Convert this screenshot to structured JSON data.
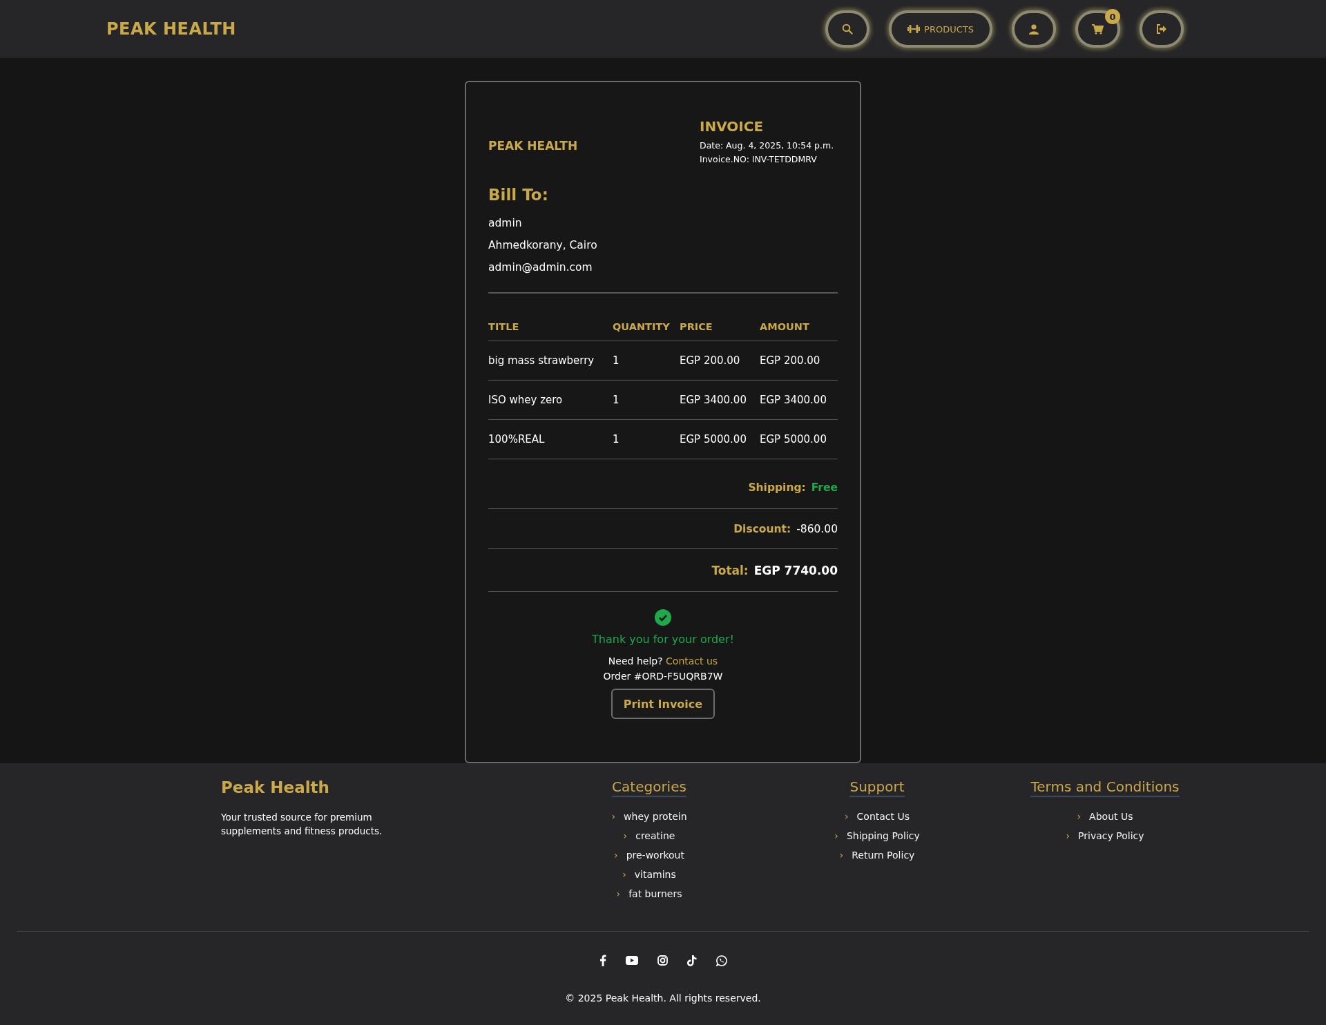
{
  "header": {
    "logo": "PEAK HEALTH",
    "nav": [
      {
        "kind": "search"
      },
      {
        "kind": "products",
        "label": "PRODUCTS"
      },
      {
        "kind": "user"
      },
      {
        "kind": "cart",
        "badge": "0"
      },
      {
        "kind": "logout"
      }
    ]
  },
  "invoice": {
    "brand": "PEAK HEALTH",
    "title": "INVOICE",
    "date": "Date: Aug. 4, 2025, 10:54 p.m.",
    "number": "Invoice.NO: INV-TETDDMRV",
    "bill_to": {
      "heading": "Bill To:",
      "lines": [
        "admin",
        "Ahmedkorany, Cairo",
        "admin@admin.com"
      ]
    },
    "table": {
      "columns": [
        "TITLE",
        "QUANTITY",
        "PRICE",
        "AMOUNT"
      ],
      "rows": [
        [
          "big mass strawberry",
          "1",
          "EGP 200.00",
          "EGP 200.00"
        ],
        [
          "ISO whey zero",
          "1",
          "EGP 3400.00",
          "EGP 3400.00"
        ],
        [
          "100%REAL",
          "1",
          "EGP 5000.00",
          "EGP 5000.00"
        ]
      ]
    },
    "summary": [
      {
        "kind": "free",
        "label": "Shipping:",
        "value": "Free"
      },
      {
        "kind": "plain",
        "label": "Discount:",
        "value": "-860.00"
      },
      {
        "kind": "total",
        "label": "Total:",
        "value": "EGP 7740.00"
      }
    ],
    "thanks": "Thank you for your order!",
    "help": "Need help?",
    "contact_link": "Contact us",
    "order": "Order #ORD-F5UQRB7W",
    "print_button": "Print Invoice"
  },
  "footer": {
    "brand": "Peak Health",
    "tagline": "Your trusted source for premium supplements and fitness products.",
    "columns": [
      {
        "heading": "Categories",
        "marker": "›",
        "links": [
          "whey protein",
          "creatine",
          "pre-workout",
          "vitamins",
          "fat burners"
        ]
      },
      {
        "heading": "Support",
        "marker": "›",
        "links": [
          "Contact Us",
          "Shipping Policy",
          "Return Policy"
        ]
      },
      {
        "heading": "Terms and Conditions",
        "marker": "›",
        "links": [
          "About Us",
          "Privacy Policy"
        ]
      }
    ],
    "social": [
      {
        "kind": "facebook"
      },
      {
        "kind": "youtube"
      },
      {
        "kind": "instagram"
      },
      {
        "kind": "tiktok"
      },
      {
        "kind": "whatsapp"
      }
    ],
    "copyright": "© 2025 Peak Health. All rights reserved."
  }
}
